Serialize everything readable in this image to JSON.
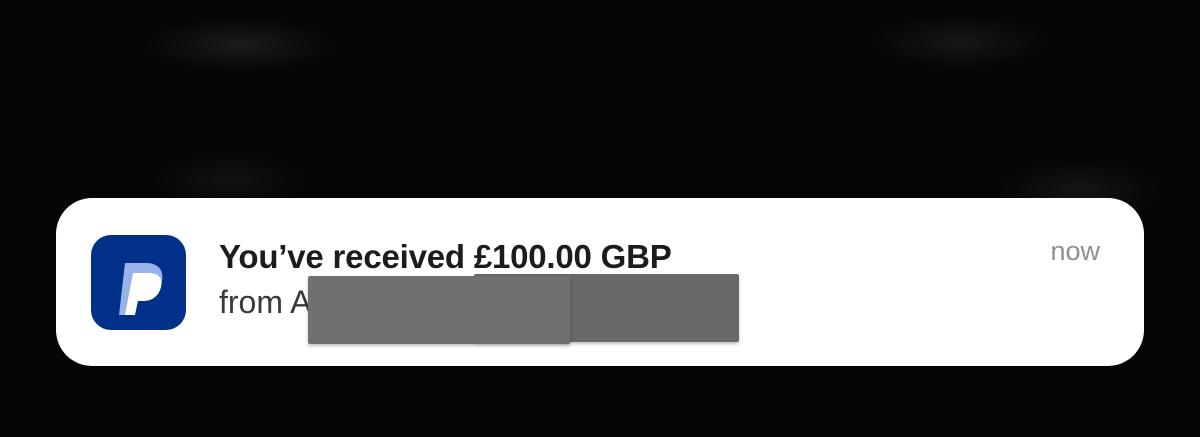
{
  "notification": {
    "app_icon": "paypal-icon",
    "title": "You’ve received £100.00 GBP",
    "body": "from A",
    "timestamp": "now"
  },
  "colors": {
    "app_icon_background": "#003087",
    "card_background": "#ffffff",
    "redaction": "#6b6b6b"
  }
}
